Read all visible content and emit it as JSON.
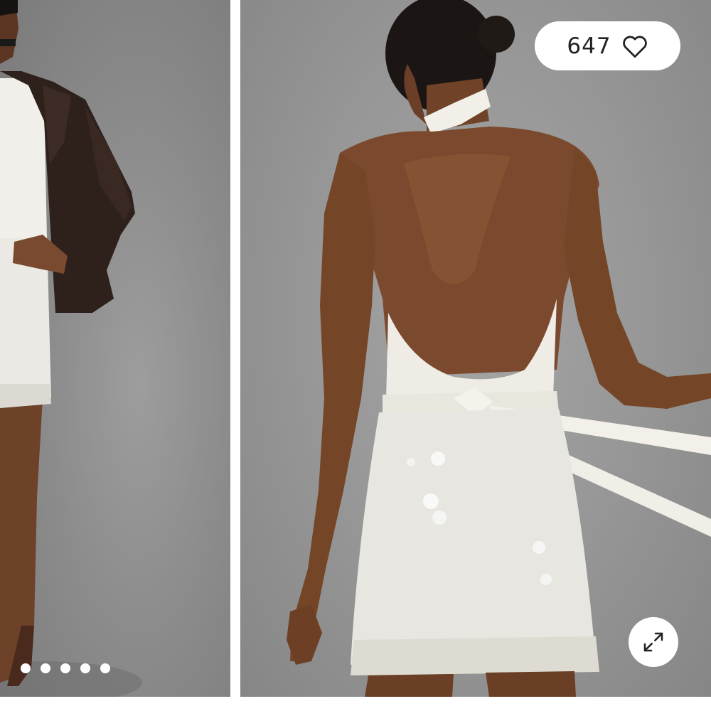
{
  "gallery": {
    "like_count": "647",
    "icons": {
      "like": "heart-outline-icon",
      "expand": "expand-arrows-icon"
    },
    "pagination": {
      "total": 5
    },
    "colors": {
      "backdrop": "#8f8f8f",
      "overlay_button": "#ffffff",
      "skirt": "#ecebe6",
      "jacket": "#2e211c",
      "skin": "#7a4a30"
    }
  }
}
